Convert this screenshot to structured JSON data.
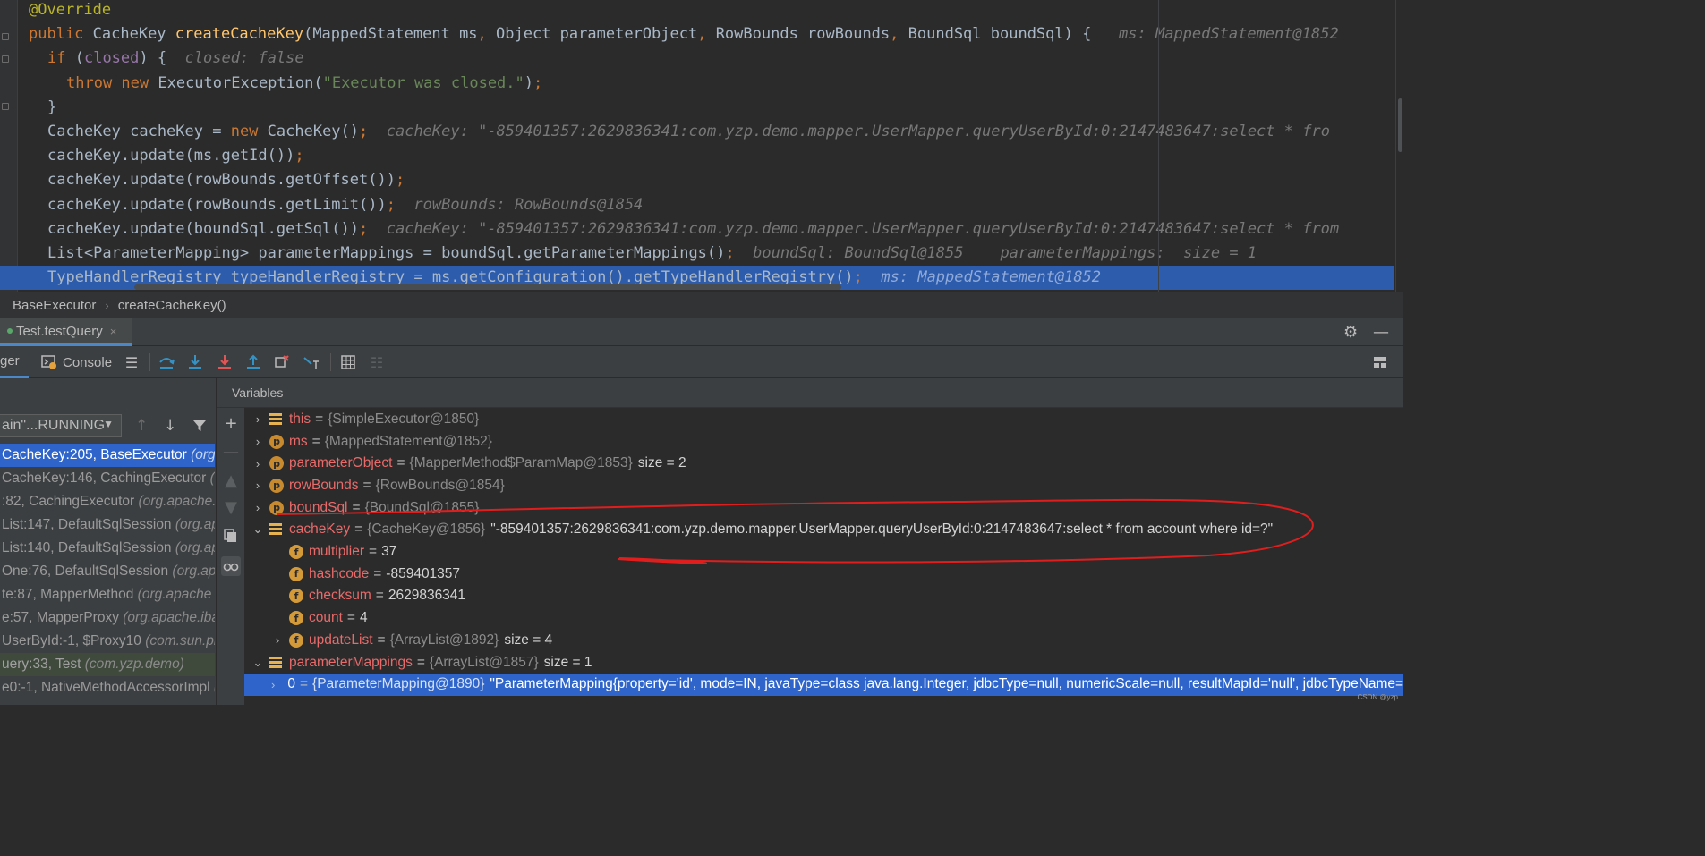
{
  "editor": {
    "lines": [
      {
        "parts": [
          {
            "t": "@Override",
            "c": "an"
          }
        ]
      },
      {
        "parts": [
          {
            "t": "public ",
            "c": "kw"
          },
          {
            "t": "CacheKey ",
            "c": ""
          },
          {
            "t": "createCacheKey",
            "c": "fn"
          },
          {
            "t": "(MappedStatement ms",
            "c": ""
          },
          {
            "t": ", ",
            "c": "kw"
          },
          {
            "t": "Object parameterObject",
            "c": ""
          },
          {
            "t": ", ",
            "c": "kw"
          },
          {
            "t": "RowBounds rowBounds",
            "c": ""
          },
          {
            "t": ", ",
            "c": "kw"
          },
          {
            "t": "BoundSql boundSql) {",
            "c": ""
          },
          {
            "t": "   ms: MappedStatement@1852",
            "c": "inl"
          }
        ]
      },
      {
        "indent": 1,
        "parts": [
          {
            "t": "if ",
            "c": "kw"
          },
          {
            "t": "(",
            "c": ""
          },
          {
            "t": "closed",
            "c": "fld"
          },
          {
            "t": ") {",
            "c": ""
          },
          {
            "t": "  closed: false",
            "c": "inl"
          }
        ]
      },
      {
        "indent": 2,
        "parts": [
          {
            "t": "throw new ",
            "c": "kw"
          },
          {
            "t": "ExecutorException(",
            "c": ""
          },
          {
            "t": "\"Executor was closed.\"",
            "c": "st"
          },
          {
            "t": ")",
            "c": ""
          },
          {
            "t": ";",
            "c": "kw"
          }
        ]
      },
      {
        "indent": 1,
        "parts": [
          {
            "t": "}",
            "c": ""
          }
        ]
      },
      {
        "indent": 1,
        "parts": [
          {
            "t": "CacheKey cacheKey = ",
            "c": ""
          },
          {
            "t": "new ",
            "c": "kw"
          },
          {
            "t": "CacheKey()",
            "c": ""
          },
          {
            "t": ";",
            "c": "kw"
          },
          {
            "t": "  cacheKey: \"-859401357:2629836341:com.yzp.demo.mapper.UserMapper.queryUserById:0:2147483647:select * fro",
            "c": "inl"
          }
        ]
      },
      {
        "indent": 1,
        "parts": [
          {
            "t": "cacheKey.update(ms.getId())",
            "c": ""
          },
          {
            "t": ";",
            "c": "kw"
          }
        ]
      },
      {
        "indent": 1,
        "parts": [
          {
            "t": "cacheKey.update(rowBounds.getOffset())",
            "c": ""
          },
          {
            "t": ";",
            "c": "kw"
          }
        ]
      },
      {
        "indent": 1,
        "parts": [
          {
            "t": "cacheKey.update(rowBounds.getLimit())",
            "c": ""
          },
          {
            "t": ";",
            "c": "kw"
          },
          {
            "t": "  rowBounds: RowBounds@1854",
            "c": "inl"
          }
        ]
      },
      {
        "indent": 1,
        "parts": [
          {
            "t": "cacheKey.update(boundSql.getSql())",
            "c": ""
          },
          {
            "t": ";",
            "c": "kw"
          },
          {
            "t": "  cacheKey: \"-859401357:2629836341:com.yzp.demo.mapper.UserMapper.queryUserById:0:2147483647:select * from",
            "c": "inl"
          }
        ]
      },
      {
        "indent": 1,
        "parts": [
          {
            "t": "List<ParameterMapping> parameterMappings = boundSql.getParameterMappings()",
            "c": ""
          },
          {
            "t": ";",
            "c": "kw"
          },
          {
            "t": "  boundSql: BoundSql@1855    parameterMappings:  size = 1",
            "c": "inl"
          }
        ]
      },
      {
        "indent": 1,
        "highlight": true,
        "parts": [
          {
            "t": "TypeHandlerRegistry typeHandlerRegistry = ms.getConfiguration().getTypeHandlerRegistry()",
            "c": ""
          },
          {
            "t": ";",
            "c": "kw"
          },
          {
            "t": "  ms: MappedStatement@1852",
            "c": "inl"
          }
        ]
      }
    ]
  },
  "breadcrumb": {
    "file": "BaseExecutor",
    "sep": "›",
    "method": "createCacheKey()"
  },
  "run_tab": {
    "label": "Test.testQuery",
    "close": "×"
  },
  "toolbar": {
    "debugger_label": "ger",
    "console_label": "Console"
  },
  "thread": {
    "label": "ain\"...RUNNING"
  },
  "frames": [
    {
      "text": "CacheKey:205, BaseExecutor ",
      "cls": "(org.a",
      "state": "sel"
    },
    {
      "text": "CacheKey:146, CachingExecutor ",
      "cls": "(o",
      "state": "lib"
    },
    {
      "text": ":82, CachingExecutor ",
      "cls": "(org.apache.i",
      "state": "lib"
    },
    {
      "text": "List:147, DefaultSqlSession ",
      "cls": "(org.ap",
      "state": "lib"
    },
    {
      "text": "List:140, DefaultSqlSession ",
      "cls": "(org.ap",
      "state": "lib"
    },
    {
      "text": "One:76, DefaultSqlSession ",
      "cls": "(org.apa",
      "state": "lib"
    },
    {
      "text": "te:87, MapperMethod ",
      "cls": "(org.apache",
      "state": "lib"
    },
    {
      "text": "e:57, MapperProxy ",
      "cls": "(org.apache.iba",
      "state": "lib"
    },
    {
      "text": "UserById:-1, $Proxy10 ",
      "cls": "(com.sun.pr",
      "state": "lib"
    },
    {
      "text": "uery:33, Test ",
      "cls": "(com.yzp.demo)",
      "state": "user"
    },
    {
      "text": "e0:-1, NativeMethodAccessorImpl ",
      "cls": "(",
      "state": "lib"
    }
  ],
  "variables_header": "Variables",
  "variables": [
    {
      "indent": 0,
      "chev": "›",
      "icon": "list",
      "name": "this",
      "type": "{SimpleExecutor@1850}",
      "extra": ""
    },
    {
      "indent": 0,
      "chev": "›",
      "icon": "p",
      "name": "ms",
      "type": "{MappedStatement@1852}",
      "extra": ""
    },
    {
      "indent": 0,
      "chev": "›",
      "icon": "p",
      "name": "parameterObject",
      "type": "{MapperMethod$ParamMap@1853}",
      "extra": "size = 2"
    },
    {
      "indent": 0,
      "chev": "›",
      "icon": "p",
      "name": "rowBounds",
      "type": "{RowBounds@1854}",
      "extra": ""
    },
    {
      "indent": 0,
      "chev": "›",
      "icon": "p",
      "name": "boundSql",
      "type": "{BoundSql@1855}",
      "extra": ""
    },
    {
      "indent": 0,
      "chev": "⌄",
      "icon": "list",
      "name": "cacheKey",
      "type": "{CacheKey@1856}",
      "extra": "\"-859401357:2629836341:com.yzp.demo.mapper.UserMapper.queryUserById:0:2147483647:select * from account where id=?\""
    },
    {
      "indent": 1,
      "chev": "",
      "icon": "f",
      "name": "multiplier",
      "type": "",
      "extra": "37"
    },
    {
      "indent": 1,
      "chev": "",
      "icon": "f",
      "name": "hashcode",
      "type": "",
      "extra": "-859401357"
    },
    {
      "indent": 1,
      "chev": "",
      "icon": "f",
      "name": "checksum",
      "type": "",
      "extra": "2629836341"
    },
    {
      "indent": 1,
      "chev": "",
      "icon": "f",
      "name": "count",
      "type": "",
      "extra": "4"
    },
    {
      "indent": 1,
      "chev": "›",
      "icon": "f",
      "name": "updateList",
      "type": "{ArrayList@1892}",
      "extra": "size = 4"
    },
    {
      "indent": 0,
      "chev": "⌄",
      "icon": "list",
      "name": "parameterMappings",
      "type": "{ArrayList@1857}",
      "extra": "size = 1"
    },
    {
      "indent": 1,
      "chev": "›",
      "icon": "list",
      "name": "0",
      "type": "{ParameterMapping@1890}",
      "extra": "\"ParameterMapping{property='id', mode=IN, javaType=class java.lang.Integer, jdbcType=null, numericScale=null, resultMapId='null', jdbcTypeName='null'\"",
      "selected": true
    }
  ],
  "watermark": "CSDN @yzp",
  "colors": {
    "accent": "#2f65ca",
    "annotation": "#e01e1e"
  }
}
